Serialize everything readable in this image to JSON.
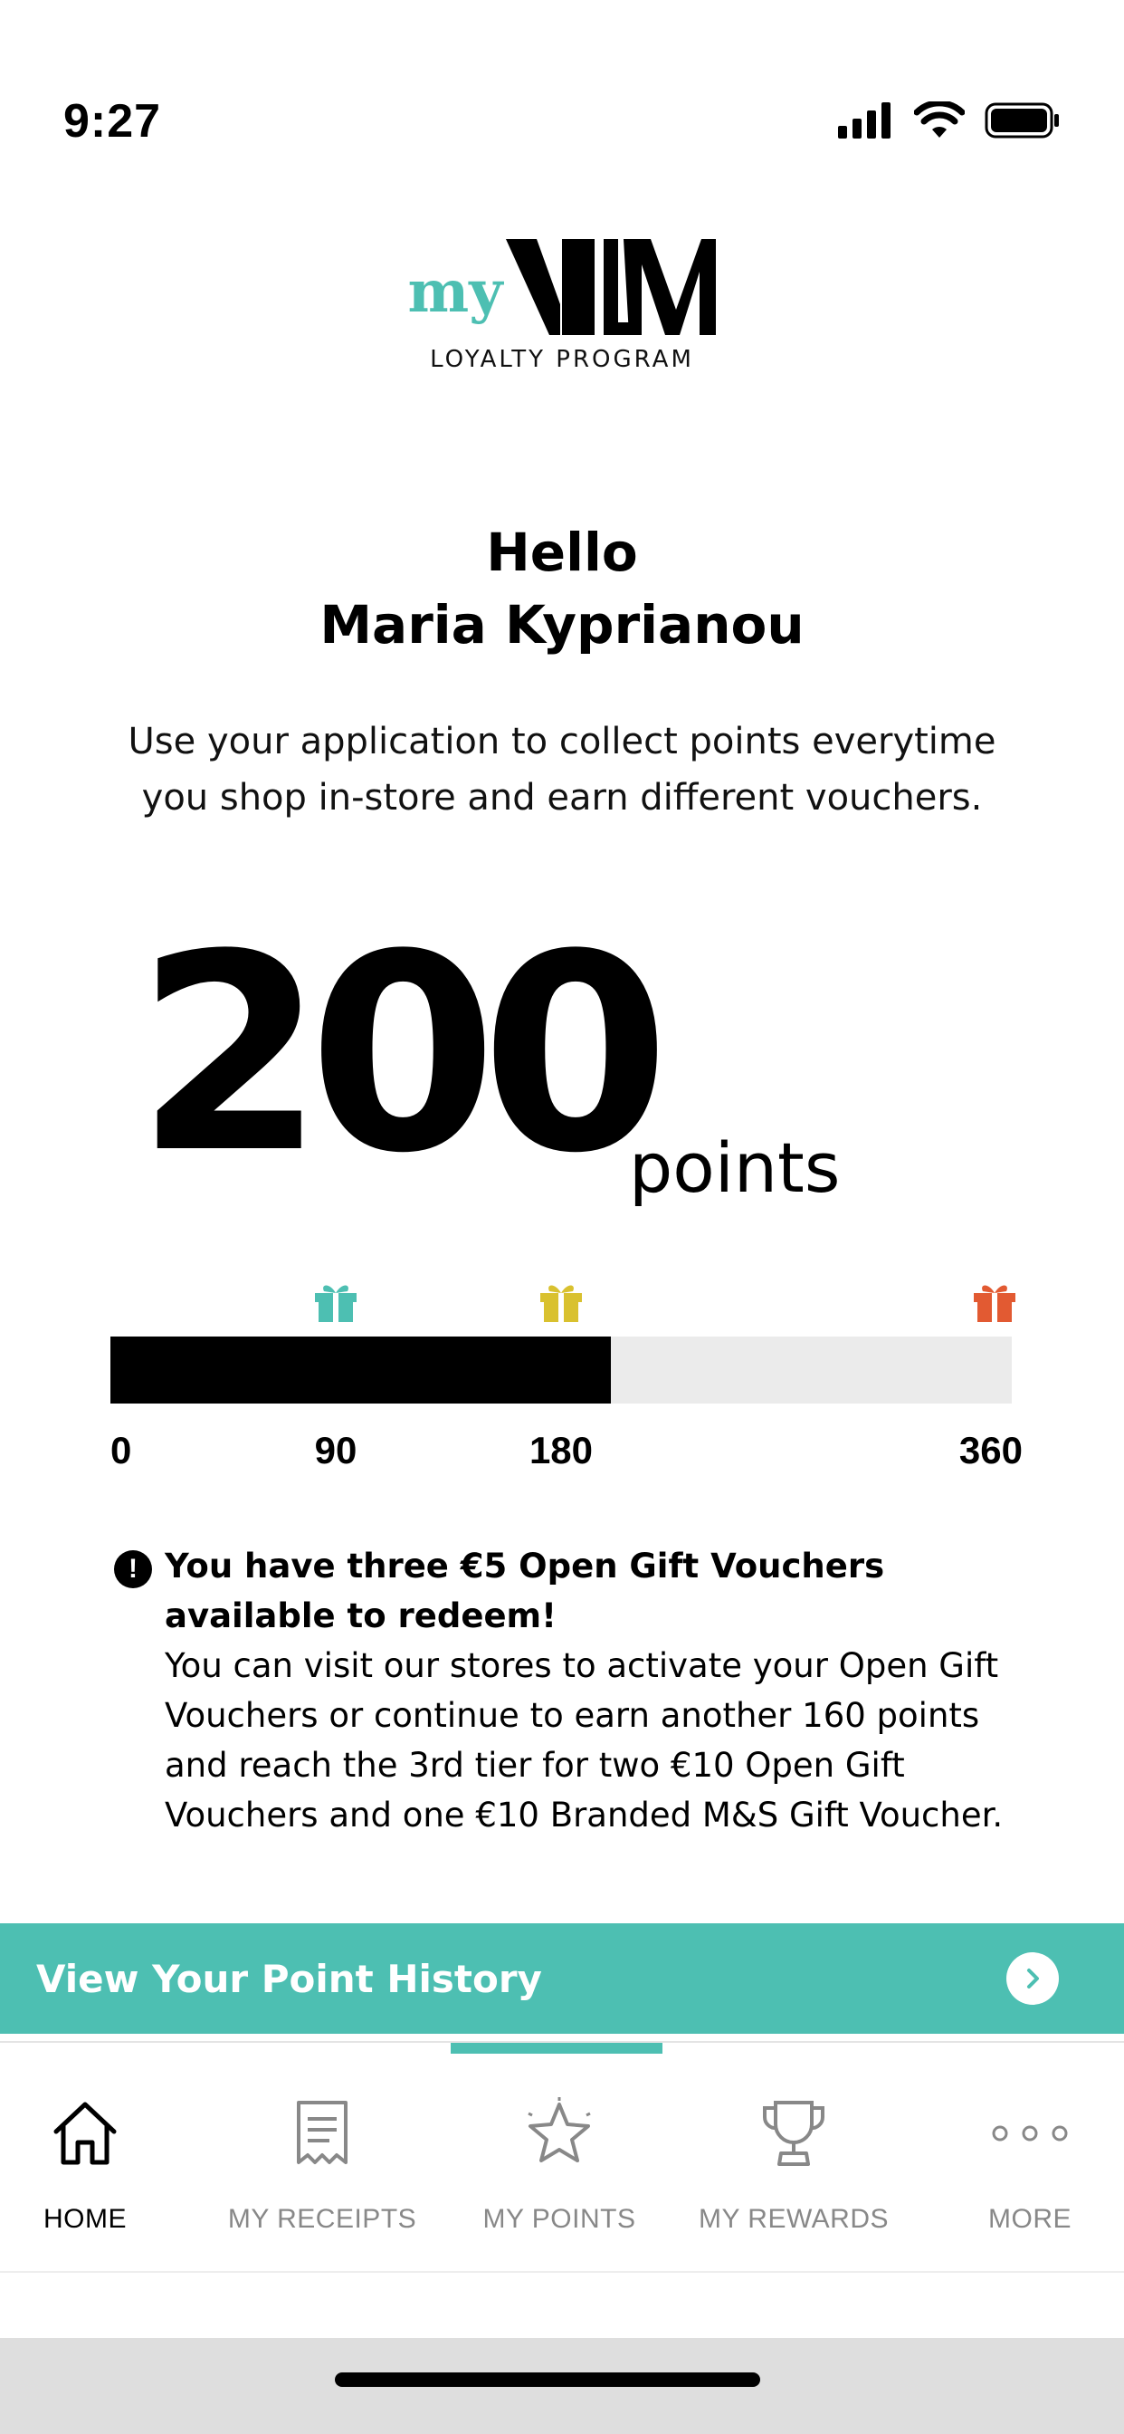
{
  "status_bar": {
    "time": "9:27"
  },
  "logo": {
    "prefix": "my",
    "brand": "MM",
    "subtitle": "LOYALTY PROGRAM"
  },
  "greeting": {
    "line1": "Hello",
    "line2": "Maria Kyprianou"
  },
  "intro": "Use your application to collect points everytime you shop in-store and earn different vouchers.",
  "points": {
    "value": "200",
    "unit": "points"
  },
  "progress": {
    "current": 200,
    "max": 360,
    "ticks": [
      "0",
      "90",
      "180",
      "360"
    ],
    "gift_colors": [
      "#4dbfb2",
      "#d9c12f",
      "#e25a32"
    ]
  },
  "notice": {
    "title": "You have three €5 Open Gift Vouchers available to redeem!",
    "body": "You can visit our stores to activate your Open Gift Vouchers or continue to earn another 160 points and reach the 3rd tier for two €10 Open Gift Vouchers and one €10 Branded M&S Gift Voucher."
  },
  "history_button": {
    "label": "View Your Point History"
  },
  "tabbar": {
    "items": [
      {
        "label": "HOME",
        "icon": "house-icon"
      },
      {
        "label": "MY RECEIPTS",
        "icon": "receipt-icon"
      },
      {
        "label": "MY POINTS",
        "icon": "star-icon"
      },
      {
        "label": "MY REWARDS",
        "icon": "trophy-icon"
      },
      {
        "label": "MORE",
        "icon": "more-dots-icon"
      }
    ]
  },
  "colors": {
    "accent": "#4dbfb2",
    "track": "#ebebeb"
  }
}
